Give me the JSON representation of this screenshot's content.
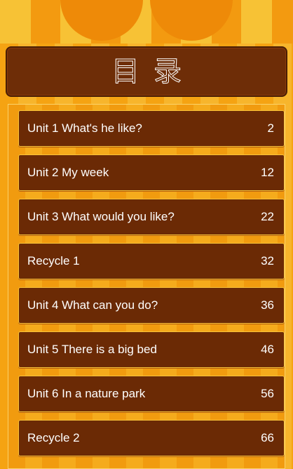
{
  "header": {
    "title_char_1": "目",
    "title_char_2": "录"
  },
  "toc": {
    "items": [
      {
        "label": "Unit 1 What's he like?",
        "page": "2"
      },
      {
        "label": "Unit 2 My week",
        "page": "12"
      },
      {
        "label": "Unit 3 What would you like?",
        "page": "22"
      },
      {
        "label": "Recycle 1",
        "page": "32"
      },
      {
        "label": "Unit 4 What can you do?",
        "page": "36"
      },
      {
        "label": "Unit 5 There is a big bed",
        "page": "46"
      },
      {
        "label": "Unit 6 In a nature park",
        "page": "56"
      },
      {
        "label": "Recycle 2",
        "page": "66"
      }
    ]
  }
}
